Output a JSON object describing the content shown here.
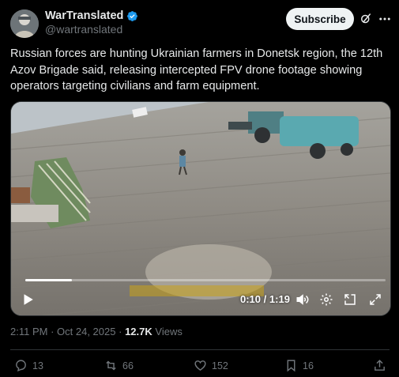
{
  "author": {
    "display_name": "WarTranslated",
    "handle": "@wartranslated",
    "verified": true,
    "avatar_icon": "avatar-image"
  },
  "header": {
    "subscribe_label": "Subscribe",
    "grok_icon": "grok-icon",
    "more_icon": "more-icon"
  },
  "tweet": {
    "text": "Russian forces are hunting Ukrainian farmers in Donetsk region, the 12th Azov Brigade said, releasing intercepted FPV drone footage showing operators targeting civilians and farm equipment."
  },
  "video": {
    "elapsed": "0:10",
    "separator": "/",
    "duration": "1:19",
    "progress_fraction": 0.13,
    "controls": [
      "play-icon",
      "volume-icon",
      "settings-icon",
      "pip-icon",
      "fullscreen-icon"
    ]
  },
  "meta": {
    "time": "2:11 PM",
    "date": "Oct 24, 2025",
    "views_count": "12.7K",
    "views_label": "Views"
  },
  "actions": {
    "replies": "13",
    "reposts": "66",
    "likes": "152",
    "bookmarks": "16"
  },
  "colors": {
    "background": "#000000",
    "text_primary": "#e7e9ea",
    "text_secondary": "#71767b",
    "verified_blue": "#1d9bf0",
    "button_bg": "#eff3f4"
  }
}
